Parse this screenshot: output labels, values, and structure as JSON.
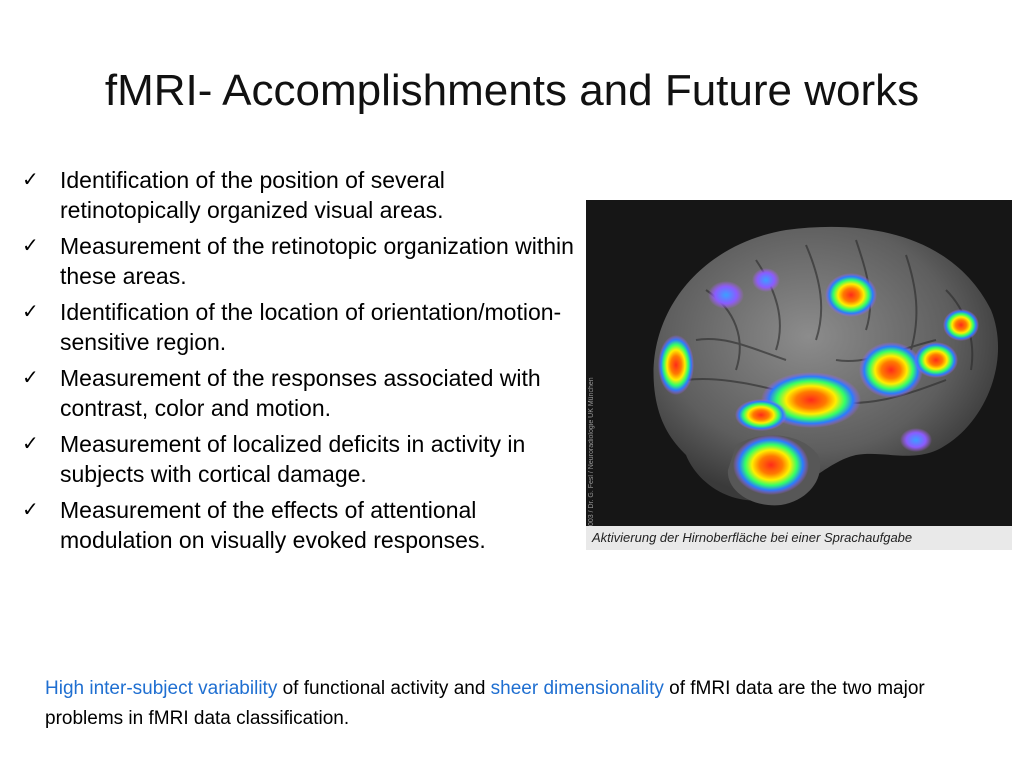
{
  "slide": {
    "title": "fMRI- Accomplishments and Future works",
    "bullets": [
      {
        "icon": "checkmark-icon",
        "text": "Identification of the position of several retinotopically organized visual areas."
      },
      {
        "icon": "checkmark-icon",
        "text": "Measurement of the retinotopic organization within these areas."
      },
      {
        "icon": "checkmark-icon",
        "text": "Identification of the location of orientation/motion-sensitive region."
      },
      {
        "icon": "checkmark-icon",
        "text": "Measurement of the responses associated with contrast, color and motion."
      },
      {
        "icon": "checkmark-icon",
        "text": "Measurement of localized deficits in activity in subjects with cortical damage."
      },
      {
        "icon": "checkmark-icon",
        "text": "Measurement of the effects of attentional modulation on visually evoked responses."
      }
    ],
    "figure": {
      "credit": "(c) 2003 / Dr. G. Fesl / Neuroradiologie UK München",
      "caption": "Aktivierung der Hirnoberfläche bei einer Sprachaufgabe"
    },
    "footnote": {
      "highlight1": "High inter-subject variability",
      "text1": " of functional activity and ",
      "highlight2": "sheer dimensionality",
      "text2": " of fMRI data are the two major problems in fMRI data classification."
    },
    "colors": {
      "highlight": "#1f6fd1",
      "background": "#ffffff",
      "photo_background": "#161616"
    }
  }
}
